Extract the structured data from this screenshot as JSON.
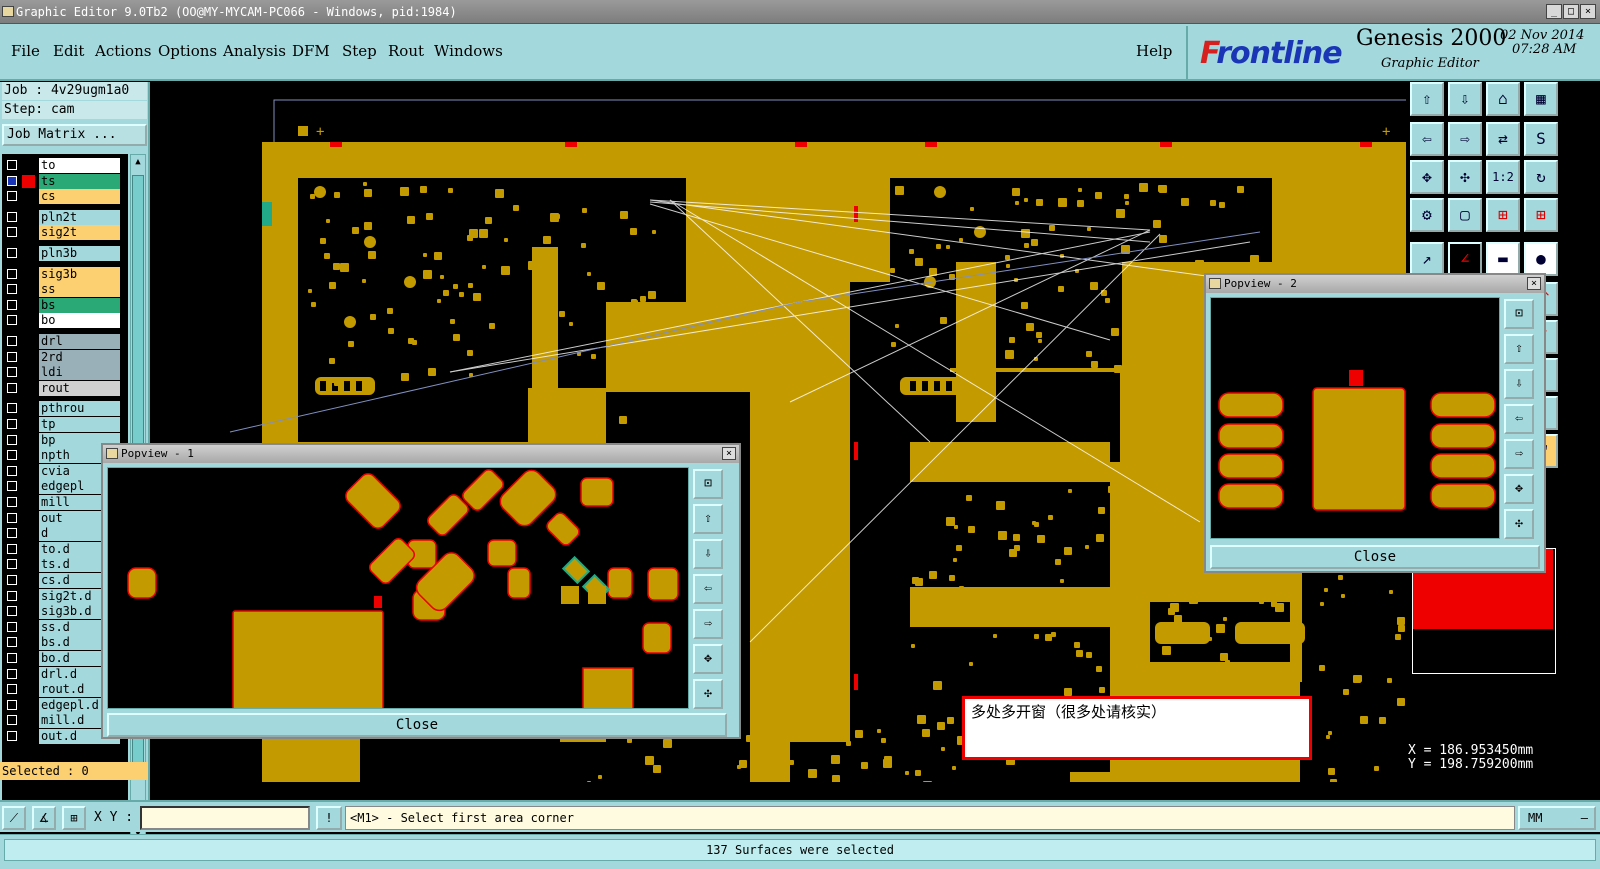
{
  "window": {
    "title": "Graphic Editor 9.0Tb2 (OO@MY-MYCAM-PC066 - Windows, pid:1984)"
  },
  "menu": {
    "items": [
      "File",
      "Edit",
      "Actions",
      "Options",
      "Analysis",
      "DFM",
      "Step",
      "Rout",
      "Windows"
    ],
    "help": "Help"
  },
  "brand": {
    "logo": "Frontline",
    "product": "Genesis 2000",
    "subtitle": "Graphic Editor",
    "date": "02 Nov 2014",
    "time": "07:28 AM"
  },
  "job": {
    "job_label": "Job : 4v29ugm1a0",
    "step_label": "Step: cam",
    "matrix_button": "Job Matrix ..."
  },
  "layers": [
    {
      "name": "to",
      "color": "#ffffff"
    },
    {
      "name": "ts",
      "color": "#2aa876",
      "affected": true
    },
    {
      "name": "cs",
      "color": "#fcd070"
    },
    {
      "name": "pln2t",
      "color": "#a3d8dc"
    },
    {
      "name": "sig2t",
      "color": "#fcd070"
    },
    {
      "name": "pln3b",
      "color": "#a3d8dc"
    },
    {
      "name": "sig3b",
      "color": "#fcd070"
    },
    {
      "name": "ss",
      "color": "#fcd070"
    },
    {
      "name": "bs",
      "color": "#2aa876"
    },
    {
      "name": "bo",
      "color": "#ffffff"
    },
    {
      "name": "drl",
      "color": "#9ab0b8"
    },
    {
      "name": "2rd",
      "color": "#9ab0b8"
    },
    {
      "name": "ldi",
      "color": "#9ab0b8"
    },
    {
      "name": "rout",
      "color": "#d0d0d0"
    },
    {
      "name": "pthrou",
      "color": "#a3d8dc"
    },
    {
      "name": "tp",
      "color": "#a3d8dc"
    },
    {
      "name": "bp",
      "color": "#a3d8dc"
    },
    {
      "name": "npth",
      "color": "#a3d8dc"
    },
    {
      "name": "cvia",
      "color": "#a3d8dc"
    },
    {
      "name": "edgepl",
      "color": "#a3d8dc"
    },
    {
      "name": "mill",
      "color": "#a3d8dc"
    },
    {
      "name": "out",
      "color": "#a3d8dc"
    },
    {
      "name": "d",
      "color": "#a3d8dc"
    },
    {
      "name": "to.d",
      "color": "#a3d8dc"
    },
    {
      "name": "ts.d",
      "color": "#a3d8dc"
    },
    {
      "name": "cs.d",
      "color": "#a3d8dc"
    },
    {
      "name": "sig2t.d",
      "color": "#a3d8dc"
    },
    {
      "name": "sig3b.d",
      "color": "#a3d8dc"
    },
    {
      "name": "ss.d",
      "color": "#a3d8dc"
    },
    {
      "name": "bs.d",
      "color": "#a3d8dc"
    },
    {
      "name": "bo.d",
      "color": "#a3d8dc"
    },
    {
      "name": "drl.d",
      "color": "#a3d8dc"
    },
    {
      "name": "rout.d",
      "color": "#a3d8dc"
    },
    {
      "name": "edgepl.d",
      "color": "#a3d8dc"
    },
    {
      "name": "mill.d",
      "color": "#a3d8dc"
    },
    {
      "name": "out.d",
      "color": "#a3d8dc"
    }
  ],
  "selected": "Selected : 0",
  "popview1": {
    "title": "Popview - 1",
    "close": "Close"
  },
  "popview2": {
    "title": "Popview - 2",
    "close": "Close"
  },
  "note": "多处多开窗（很多处请核实）",
  "coords": {
    "x": "X = 186.953450mm",
    "y": "Y = 198.759200mm"
  },
  "cmd": {
    "xy_label": "X Y :",
    "xy_value": "",
    "prompt": "<M1> - Select first area corner",
    "unit": "MM"
  },
  "status": "137 Surfaces were selected",
  "colors": {
    "copper": "#c39a00",
    "panel": "#a3d8dc",
    "mask_edge": "#e00000"
  }
}
